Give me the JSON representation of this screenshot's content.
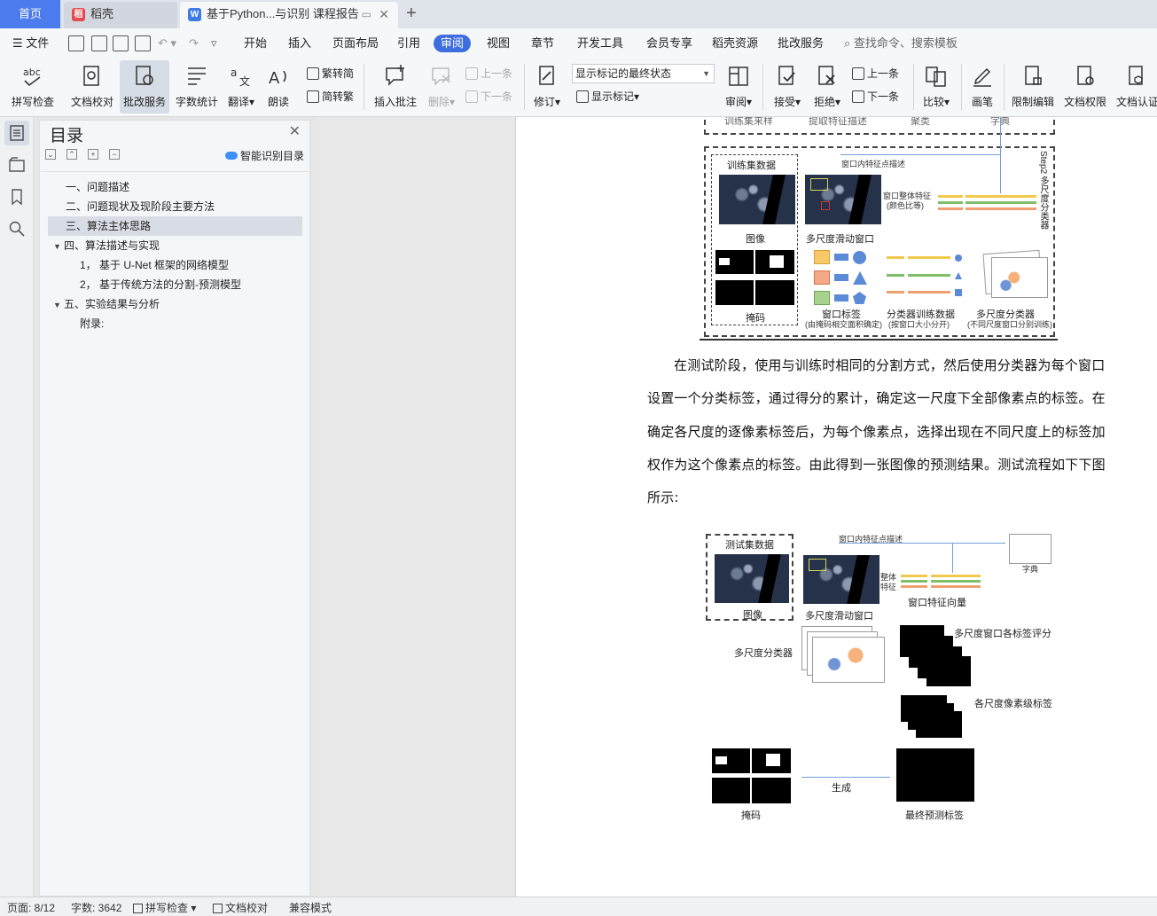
{
  "tabs": {
    "home": "首页",
    "daoke": "稻壳",
    "doc": "基于Python...与识别 课程报告",
    "add": "+"
  },
  "menu": {
    "file": "文件",
    "items": [
      "开始",
      "插入",
      "页面布局",
      "引用",
      "审阅",
      "视图",
      "章节",
      "开发工具",
      "会员专享",
      "稻壳资源",
      "批改服务"
    ],
    "active": "审阅",
    "search": "查找命令、搜索模板"
  },
  "ribbon": {
    "spell": "拼写检查",
    "proof": "文档校对",
    "correct": "批改服务",
    "wordcount": "字数统计",
    "translate": "翻译",
    "read": "朗读",
    "trad": "繁转简",
    "simp": "简转繁",
    "insert_comment": "插入批注",
    "delete": "删除",
    "prev": "上一条",
    "next": "下一条",
    "revise": "修订",
    "markup_state": "显示标记的最终状态",
    "show_markup": "显示标记",
    "review": "审阅",
    "accept": "接受",
    "reject": "拒绝",
    "prev2": "上一条",
    "next2": "下一条",
    "compare": "比较",
    "pen": "画笔",
    "restrict": "限制编辑",
    "permission": "文档权限",
    "certify": "文档认证"
  },
  "toc": {
    "title": "目录",
    "smart": "智能识别目录",
    "items": [
      "一、问题描述",
      "二、问题现状及现阶段主要方法",
      "三、算法主体思路",
      "四、算法描述与实现",
      "1， 基于 U-Net 框架的网络模型",
      "2， 基于传统方法的分割-预测模型",
      "五、实验结果与分析",
      "附录:"
    ]
  },
  "doc": {
    "fig1": {
      "top_cut": [
        "训练集来样",
        "提取特征描述",
        "聚类",
        "字典"
      ],
      "step2": "Step2 多尺度分类器",
      "train_set": "训练集数据",
      "window_desc": "窗口内特征点描述",
      "window_feat": "窗口整体特征",
      "color_ratio": "(颜色比等)",
      "image": "图像",
      "multi_window": "多尺度滑动窗口",
      "mask": "掩码",
      "window_label": "窗口标签",
      "window_label_note": "(由掩码相交面积确定)",
      "clf_data": "分类器训练数据",
      "clf_data_note": "(按窗口大小分开)",
      "multi_clf": "多尺度分类器",
      "multi_clf_note": "(不同尺度窗口分别训练)"
    },
    "paragraph": "在测试阶段，使用与训练时相同的分割方式，然后使用分类器为每个窗口设置一个分类标签，通过得分的累计，确定这一尺度下全部像素点的标签。在确定各尺度的逐像素标签后，为每个像素点，选择出现在不同尺度上的标签加权作为这个像素点的标签。由此得到一张图像的预测结果。测试流程如下下图所示:",
    "fig2": {
      "test_set": "测试集数据",
      "window_desc": "窗口内特征点描述",
      "dict": "字典",
      "whole1": "整体",
      "whole2": "特征",
      "image": "图像",
      "multi_window": "多尺度滑动窗口",
      "feat_vec": "窗口特征向量",
      "multi_clf": "多尺度分类器",
      "score": "多尺度窗口各标签评分",
      "pixel_label": "各尺度像素级标签",
      "generate": "生成",
      "mask": "掩码",
      "final": "最终预测标签"
    }
  },
  "status": {
    "page": "页面: 8/12",
    "words": "字数: 3642",
    "spell": "拼写检查",
    "proof": "文档校对",
    "compat": "兼容模式"
  },
  "colors": {
    "accent": "#3e6de0",
    "home_tab": "#4b7bec",
    "bar_yellow": "#f2c94c",
    "bar_green": "#7fbf6a",
    "bar_orange": "#f0a070"
  }
}
